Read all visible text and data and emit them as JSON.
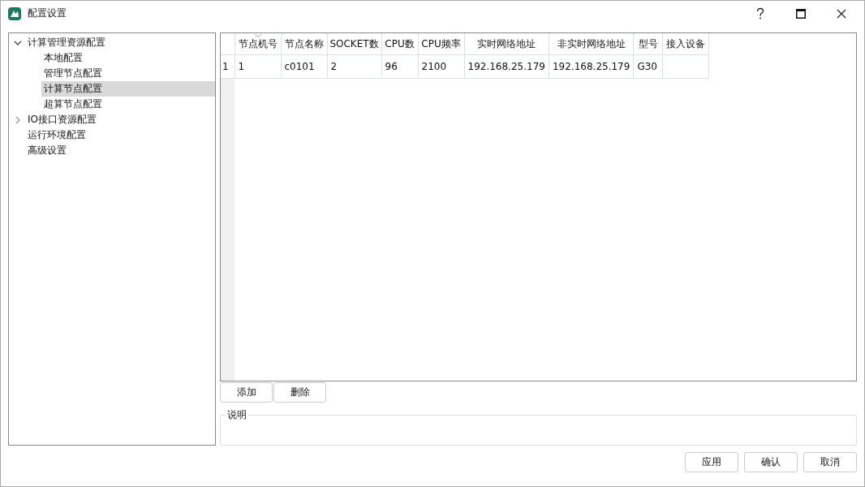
{
  "window": {
    "title": "配置设置"
  },
  "tree": [
    {
      "label": "计算管理资源配置",
      "expanded": true,
      "selected": false,
      "children": [
        {
          "label": "本地配置",
          "selected": false
        },
        {
          "label": "管理节点配置",
          "selected": false
        },
        {
          "label": "计算节点配置",
          "selected": true
        },
        {
          "label": "超算节点配置",
          "selected": false
        }
      ]
    },
    {
      "label": "IO接口资源配置",
      "expanded": false,
      "selected": false
    },
    {
      "label": "运行环境配置",
      "selected": false
    },
    {
      "label": "高级设置",
      "selected": false
    }
  ],
  "table": {
    "columns": [
      "节点机号",
      "节点名称",
      "SOCKET数",
      "CPU数",
      "CPU频率",
      "实时网络地址",
      "非实时网络地址",
      "型号",
      "接入设备"
    ],
    "rows": [
      {
        "number": "1",
        "cells": [
          "1",
          "c0101",
          "2",
          "96",
          "2100",
          "192.168.25.179",
          "192.168.25.179",
          "G30",
          ""
        ]
      }
    ]
  },
  "row_buttons": [
    "添加",
    "删除"
  ],
  "description": {
    "label": "说明"
  },
  "buttons": [
    "应用",
    "确认",
    "取消"
  ]
}
